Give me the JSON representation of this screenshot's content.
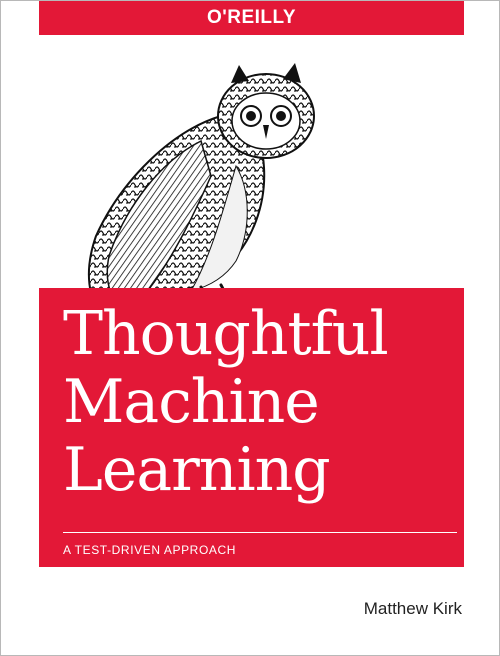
{
  "cover": {
    "publisher": "O'REILLY",
    "title_lines": [
      "Thoughtful",
      "Machine",
      "Learning"
    ],
    "subtitle": "A TEST-DRIVEN APPROACH",
    "author": "Matthew Kirk",
    "illustration_icon": "owl-illustration-icon",
    "colors": {
      "brand_red": "#e31837",
      "text_on_red": "#ffffff",
      "author_text": "#222222"
    }
  }
}
